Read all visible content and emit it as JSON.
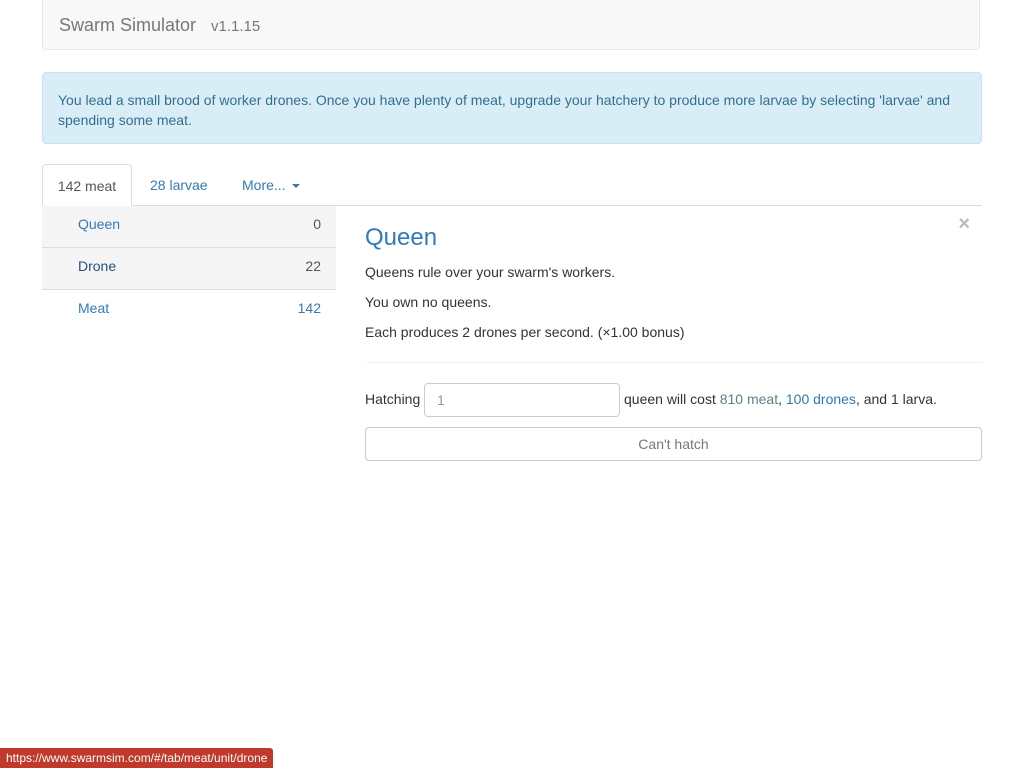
{
  "navbar": {
    "brand": "Swarm Simulator",
    "version": "v1.1.15"
  },
  "alert": {
    "text": "You lead a small brood of worker drones. Once you have plenty of meat, upgrade your hatchery to produce more larvae by selecting 'larvae' and spending some meat."
  },
  "tabs": [
    {
      "label": "142 meat",
      "active": true
    },
    {
      "label": "28 larvae",
      "active": false
    },
    {
      "label": "More...",
      "active": false
    }
  ],
  "units": [
    {
      "name": "Queen",
      "count": "0"
    },
    {
      "name": "Drone",
      "count": "22"
    },
    {
      "name": "Meat",
      "count": "142"
    }
  ],
  "detail": {
    "close": "×",
    "title": "Queen",
    "description": "Queens rule over your swarm's workers.",
    "owned": "You own no queens.",
    "production": "Each produces 2 drones per second. (×1.00 bonus)",
    "hatch_label": "Hatching",
    "hatch_value": "1",
    "cost_prefix": "queen will cost",
    "cost_meat": "810 meat",
    "cost_sep1": ",",
    "cost_drones": "100 drones",
    "cost_sep2": ", and 1 larva.",
    "button_label": "Can't hatch"
  },
  "statusbar": {
    "url": "https://www.swarmsim.com/#/tab/meat/unit/drone"
  },
  "colors": {
    "accent": "#337ab7",
    "alert_bg": "#d9edf7",
    "alert_text": "#31708f",
    "status_bg": "#c0392b"
  }
}
